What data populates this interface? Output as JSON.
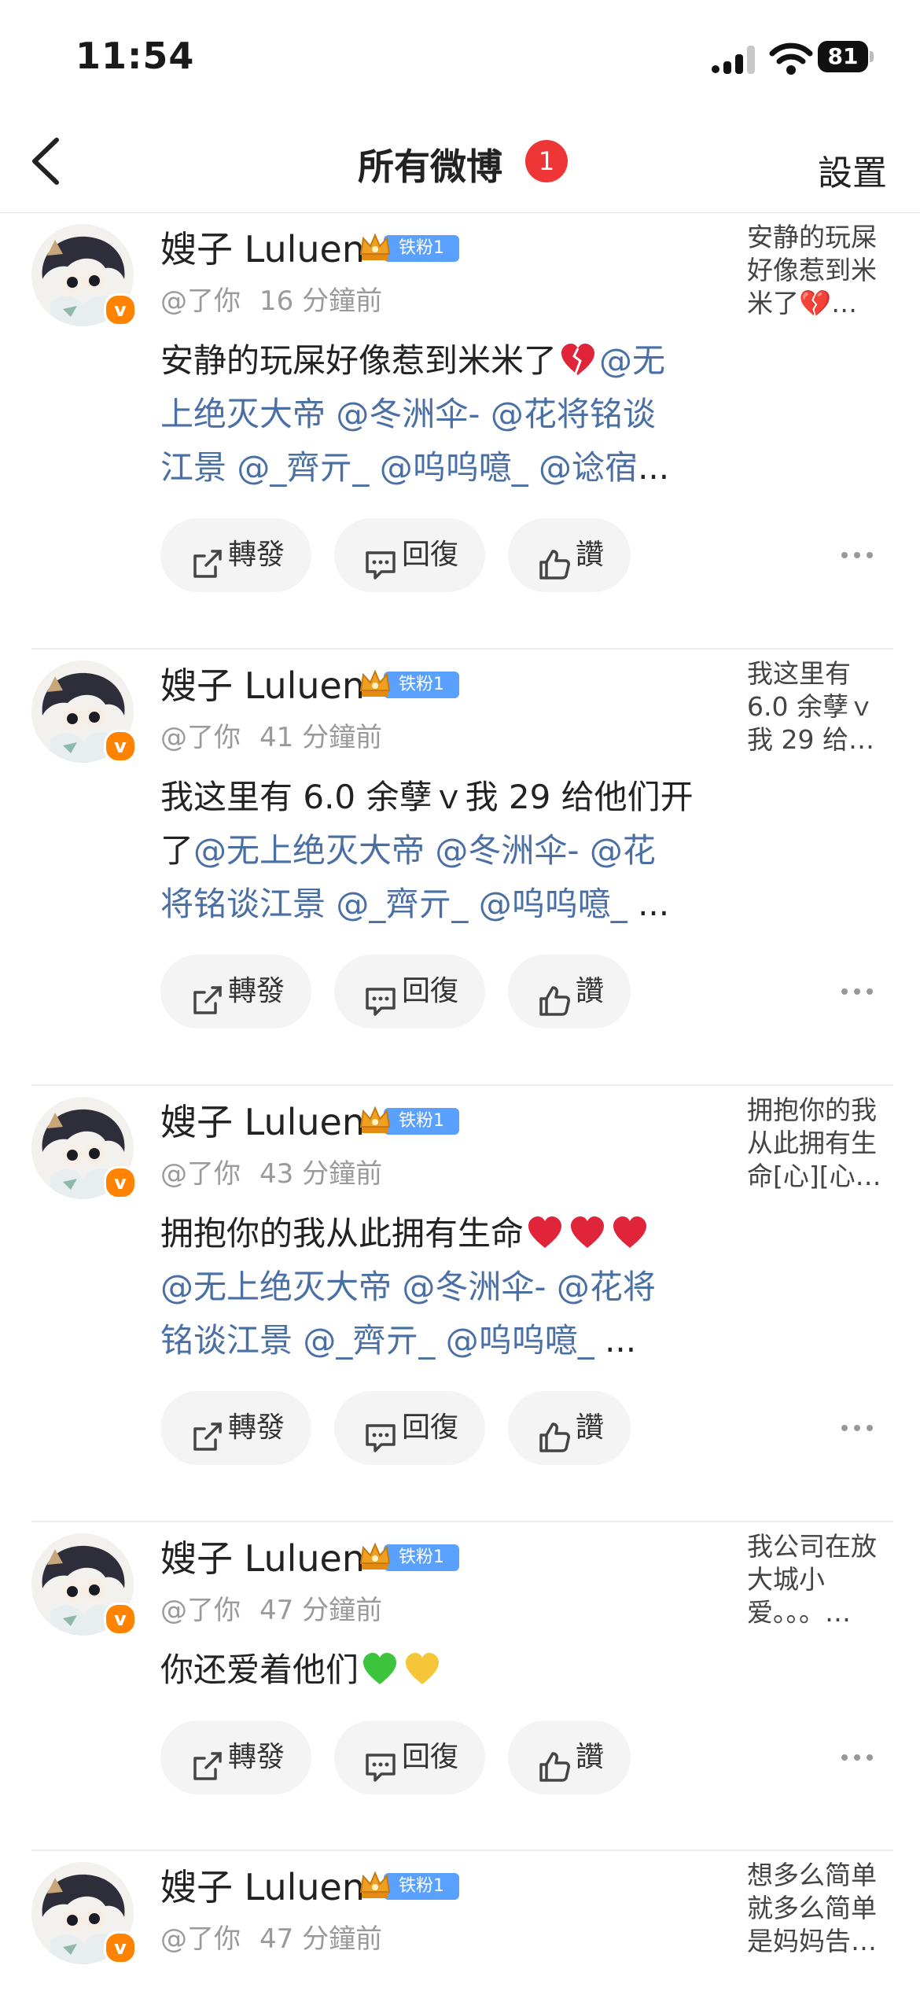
{
  "status_bar": {
    "time": "11:54",
    "battery": "81"
  },
  "nav": {
    "title": "所有微博",
    "badge": "1",
    "settings": "設置"
  },
  "user": {
    "name": "嫂子 Luluen",
    "fan_label": "铁粉1",
    "verified_mark": "v"
  },
  "actions": {
    "repost": "轉發",
    "reply": "回復",
    "like": "讚"
  },
  "posts": [
    {
      "meta_prefix": "@了你",
      "time": "16 分鐘前",
      "lines": [
        [
          {
            "t": "安静的玩屎好像惹到米米了"
          },
          {
            "emoji": "broken-heart"
          },
          {
            "m": "@无"
          }
        ],
        [
          {
            "m": "上绝灭大帝 @冬洲伞- @花将铭谈"
          }
        ],
        [
          {
            "m": "江景 @_齊亓_ @呜呜噫_ @谂宿"
          },
          {
            "t": "..."
          }
        ]
      ],
      "preview": [
        "安静的玩屎",
        "好像惹到米",
        "米了💔…"
      ]
    },
    {
      "meta_prefix": "@了你",
      "time": "41 分鐘前",
      "lines": [
        [
          {
            "t": "我这里有 6.0 余孽ｖ我 29 给他们开"
          }
        ],
        [
          {
            "t": "了"
          },
          {
            "m": "@无上绝灭大帝 @冬洲伞- @花"
          }
        ],
        [
          {
            "m": "将铭谈江景 @_齊亓_ @呜呜噫_ "
          },
          {
            "t": " ..."
          }
        ]
      ],
      "preview": [
        "我这里有",
        "6.0 余孽ｖ",
        "我 29 给…"
      ]
    },
    {
      "meta_prefix": "@了你",
      "time": "43 分鐘前",
      "lines": [
        [
          {
            "t": "拥抱你的我从此拥有生命"
          },
          {
            "emoji": "red-heart"
          },
          {
            "emoji": "red-heart"
          },
          {
            "emoji": "red-heart"
          }
        ],
        [
          {
            "m": "@无上绝灭大帝 @冬洲伞- @花将"
          }
        ],
        [
          {
            "m": "铭谈江景 @_齊亓_ @呜呜噫_ "
          },
          {
            "t": " ..."
          }
        ]
      ],
      "preview": [
        "拥抱你的我",
        "从此拥有生",
        "命[心][心…"
      ]
    },
    {
      "meta_prefix": "@了你",
      "time": "47 分鐘前",
      "lines": [
        [
          {
            "t": "你还爱着他们"
          },
          {
            "emoji": "green-heart"
          },
          {
            "emoji": "yellow-heart"
          }
        ]
      ],
      "preview": [
        "我公司在放",
        "大城小",
        "爱。。。…"
      ]
    },
    {
      "meta_prefix": "@了你",
      "time": "47 分鐘前",
      "lines": [],
      "preview": [
        "想多么简单",
        "就多么简单",
        "是妈妈告…"
      ]
    }
  ],
  "colors": {
    "mention": "#4a6fa5",
    "badge_red": "#ef3636",
    "verified_orange": "#ff8200",
    "fan_blue": "#5aa0ff"
  }
}
